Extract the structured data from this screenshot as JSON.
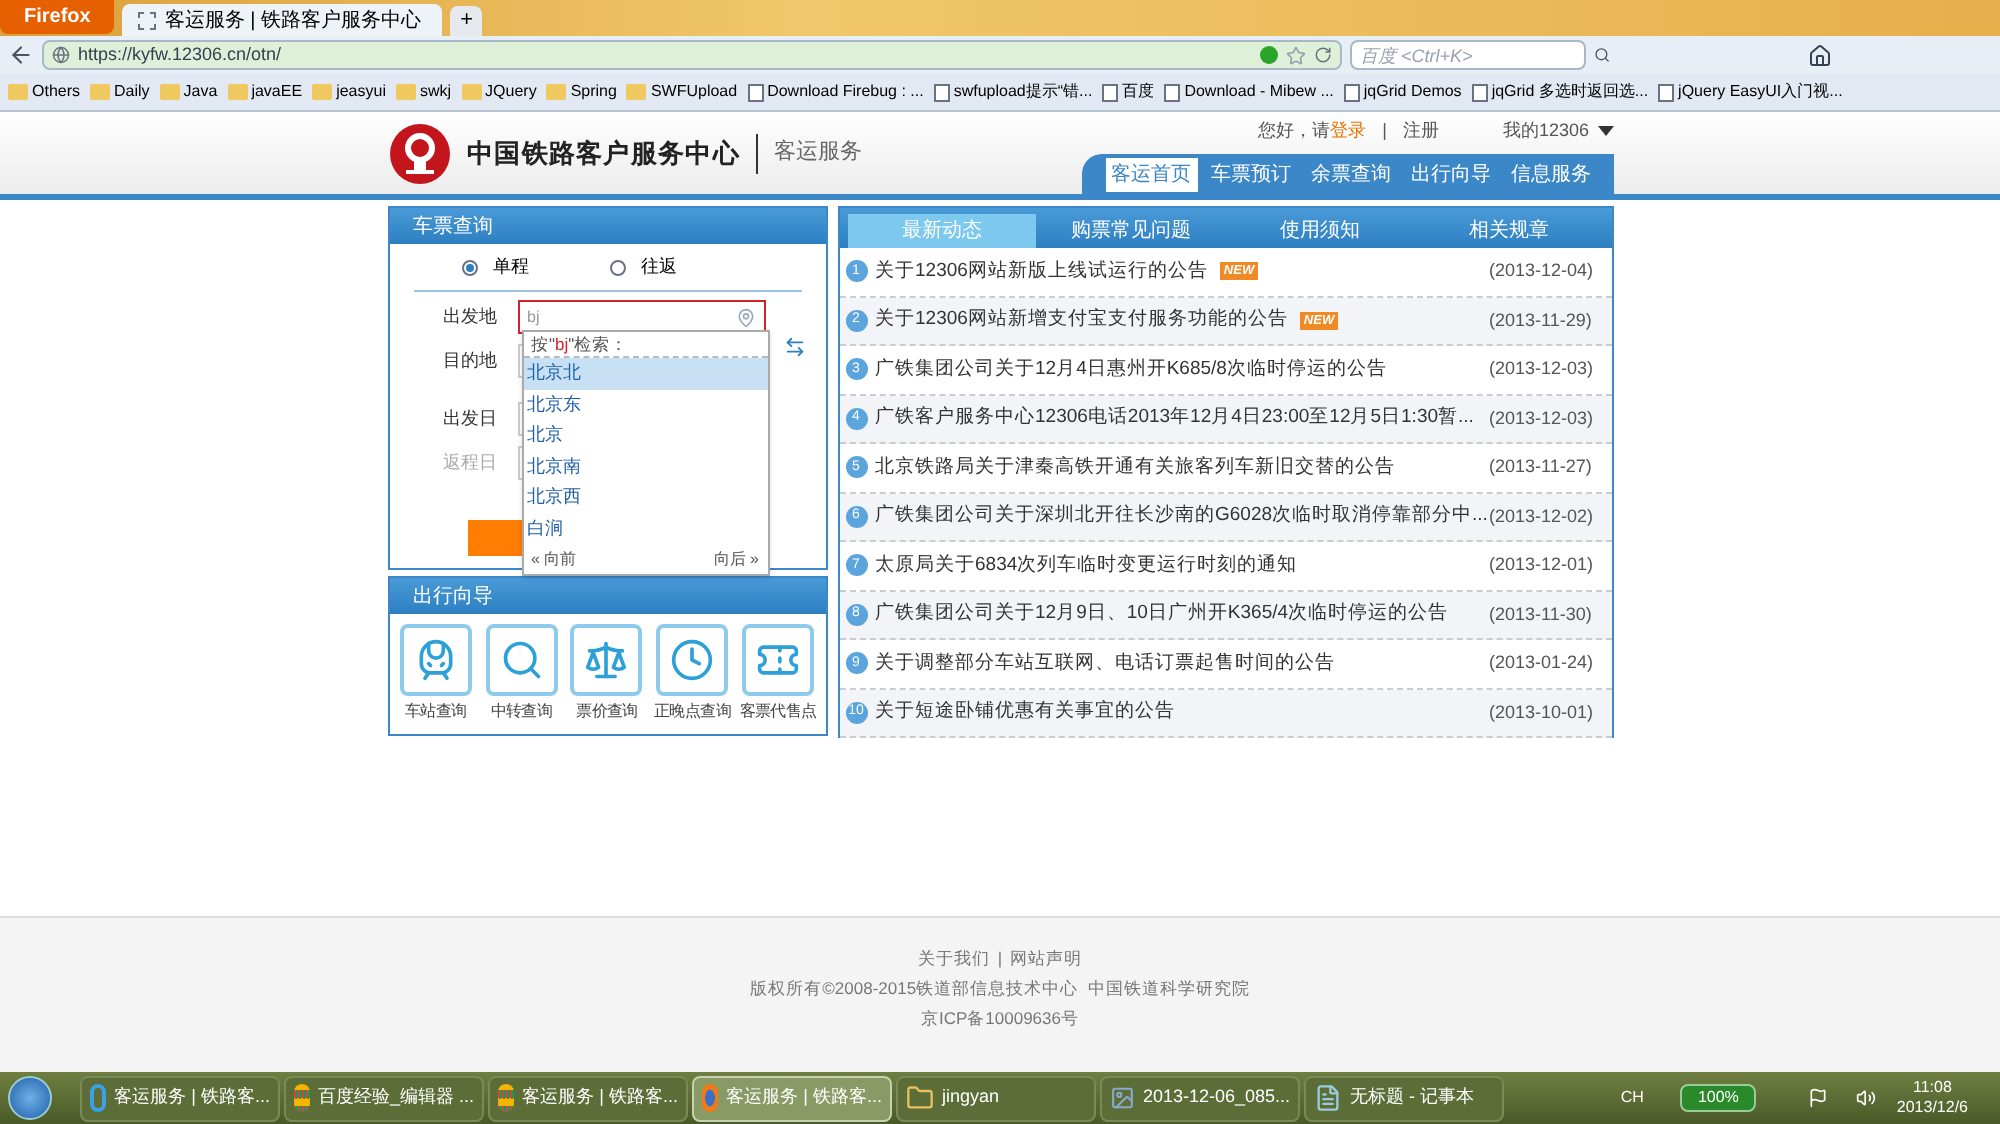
{
  "browser": {
    "app_button": "Firefox",
    "tabs": [
      {
        "title": "客运服务 | 铁路客户服务中心",
        "selected": true
      }
    ],
    "new_tab": "+",
    "url": "https://kyfw.12306.cn/otn/",
    "search_placeholder": "百度 <Ctrl+K>",
    "bookmarks": [
      {
        "label": "Others",
        "kind": "folder"
      },
      {
        "label": "Daily",
        "kind": "folder"
      },
      {
        "label": "Java",
        "kind": "folder"
      },
      {
        "label": "javaEE",
        "kind": "folder"
      },
      {
        "label": "jeasyui",
        "kind": "folder"
      },
      {
        "label": "swkj",
        "kind": "folder"
      },
      {
        "label": "JQuery",
        "kind": "folder"
      },
      {
        "label": "Spring",
        "kind": "folder"
      },
      {
        "label": "SWFUpload",
        "kind": "folder"
      },
      {
        "label": "Download Firebug : ...",
        "kind": "page"
      },
      {
        "label": "swfupload提示“错...",
        "kind": "page"
      },
      {
        "label": "百度",
        "kind": "page"
      },
      {
        "label": "Download - Mibew ...",
        "kind": "page"
      },
      {
        "label": "jqGrid Demos",
        "kind": "page"
      },
      {
        "label": "jqGrid 多选时返回选...",
        "kind": "page"
      },
      {
        "label": "jQuery EasyUI入门视...",
        "kind": "page"
      }
    ]
  },
  "header": {
    "site_name": "中国铁路客户服务中心",
    "section": "客运服务",
    "greeting": "您好，请",
    "login": "登录",
    "separator": "|",
    "register": "注册",
    "account": "我的12306",
    "nav": [
      {
        "label": "客运首页",
        "selected": true
      },
      {
        "label": "车票预订",
        "selected": false
      },
      {
        "label": "余票查询",
        "selected": false
      },
      {
        "label": "出行向导",
        "selected": false
      },
      {
        "label": "信息服务",
        "selected": false
      }
    ]
  },
  "ticket_search": {
    "title": "车票查询",
    "trip_types": [
      {
        "label": "单程",
        "selected": true
      },
      {
        "label": "往返",
        "selected": false
      }
    ],
    "fields": [
      {
        "label": "出发地",
        "value": "bj",
        "disabled": false
      },
      {
        "label": "目的地",
        "disabled": false
      },
      {
        "label": "出发日",
        "disabled": false
      },
      {
        "label": "返程日",
        "disabled": true
      }
    ],
    "suggestions": {
      "hint_before": "按\"",
      "keyword": "bj",
      "hint_after": "\"检索：",
      "items": [
        {
          "label": "北京北",
          "selected": true
        },
        {
          "label": "北京东",
          "selected": false
        },
        {
          "label": "北京",
          "selected": false
        },
        {
          "label": "北京南",
          "selected": false
        },
        {
          "label": "北京西",
          "selected": false
        },
        {
          "label": "白涧",
          "selected": false
        }
      ],
      "prev": "« 向前",
      "next": "向后 »"
    }
  },
  "travel_guide": {
    "title": "出行向导",
    "items": [
      {
        "label": "车站查询"
      },
      {
        "label": "中转查询"
      },
      {
        "label": "票价查询"
      },
      {
        "label": "正晚点查询"
      },
      {
        "label": "客票代售点"
      }
    ]
  },
  "news": {
    "tabs": [
      {
        "label": "最新动态",
        "selected": true
      },
      {
        "label": "购票常见问题",
        "selected": false
      },
      {
        "label": "使用须知",
        "selected": false
      },
      {
        "label": "相关规章",
        "selected": false
      }
    ],
    "items": [
      {
        "number": "1",
        "title": "关于12306网站新版上线试运行的公告",
        "badge": "NEW",
        "date": "(2013-12-04)"
      },
      {
        "number": "2",
        "title": "关于12306网站新增支付宝支付服务功能的公告",
        "badge": "NEW",
        "date": "(2013-11-29)"
      },
      {
        "number": "3",
        "title": "广铁集团公司关于12月4日惠州开K685/8次临时停运的公告",
        "date": "(2013-12-03)"
      },
      {
        "number": "4",
        "title": "广铁客户服务中心12306电话2013年12月4日23:00至12月5日1:30暂...",
        "date": "(2013-12-03)"
      },
      {
        "number": "5",
        "title": "北京铁路局关于津秦高铁开通有关旅客列车新旧交替的公告",
        "date": "(2013-11-27)"
      },
      {
        "number": "6",
        "title": "广铁集团公司关于深圳北开往长沙南的G6028次临时取消停靠部分中...",
        "date": "(2013-12-02)"
      },
      {
        "number": "7",
        "title": "太原局关于6834次列车临时变更运行时刻的通知",
        "date": "(2013-12-01)"
      },
      {
        "number": "8",
        "title": "广铁集团公司关于12月9日、10日广州开K365/4次临时停运的公告",
        "date": "(2013-11-30)"
      },
      {
        "number": "9",
        "title": "关于调整部分车站互联网、电话订票起售时间的公告",
        "date": "(2013-01-24)"
      },
      {
        "number": "10",
        "title": "关于短途卧铺优惠有关事宜的公告",
        "date": "(2013-10-01)"
      }
    ]
  },
  "footer": {
    "links": [
      "关于我们",
      "网站声明"
    ],
    "separator": "|",
    "copyright": "版权所有©2008-2015铁道部信息技术中心  中国铁道科学研究院",
    "icp": "京ICP备10009636号"
  },
  "taskbar": {
    "items": [
      {
        "label": "客运服务 | 铁路客...",
        "kind": "ie",
        "selected": false
      },
      {
        "label": "百度经验_编辑器 ...",
        "kind": "chrome",
        "selected": false
      },
      {
        "label": "客运服务 | 铁路客...",
        "kind": "chrome",
        "selected": false
      },
      {
        "label": "客运服务 | 铁路客...",
        "kind": "firefox",
        "selected": true
      },
      {
        "label": "jingyan",
        "kind": "folder",
        "selected": false
      },
      {
        "label": "2013-12-06_085...",
        "kind": "image",
        "selected": false
      },
      {
        "label": "无标题 - 记事本",
        "kind": "notepad",
        "selected": false
      }
    ],
    "language": "CH",
    "battery": "100%",
    "time": "11:08",
    "date": "2013/12/6"
  }
}
